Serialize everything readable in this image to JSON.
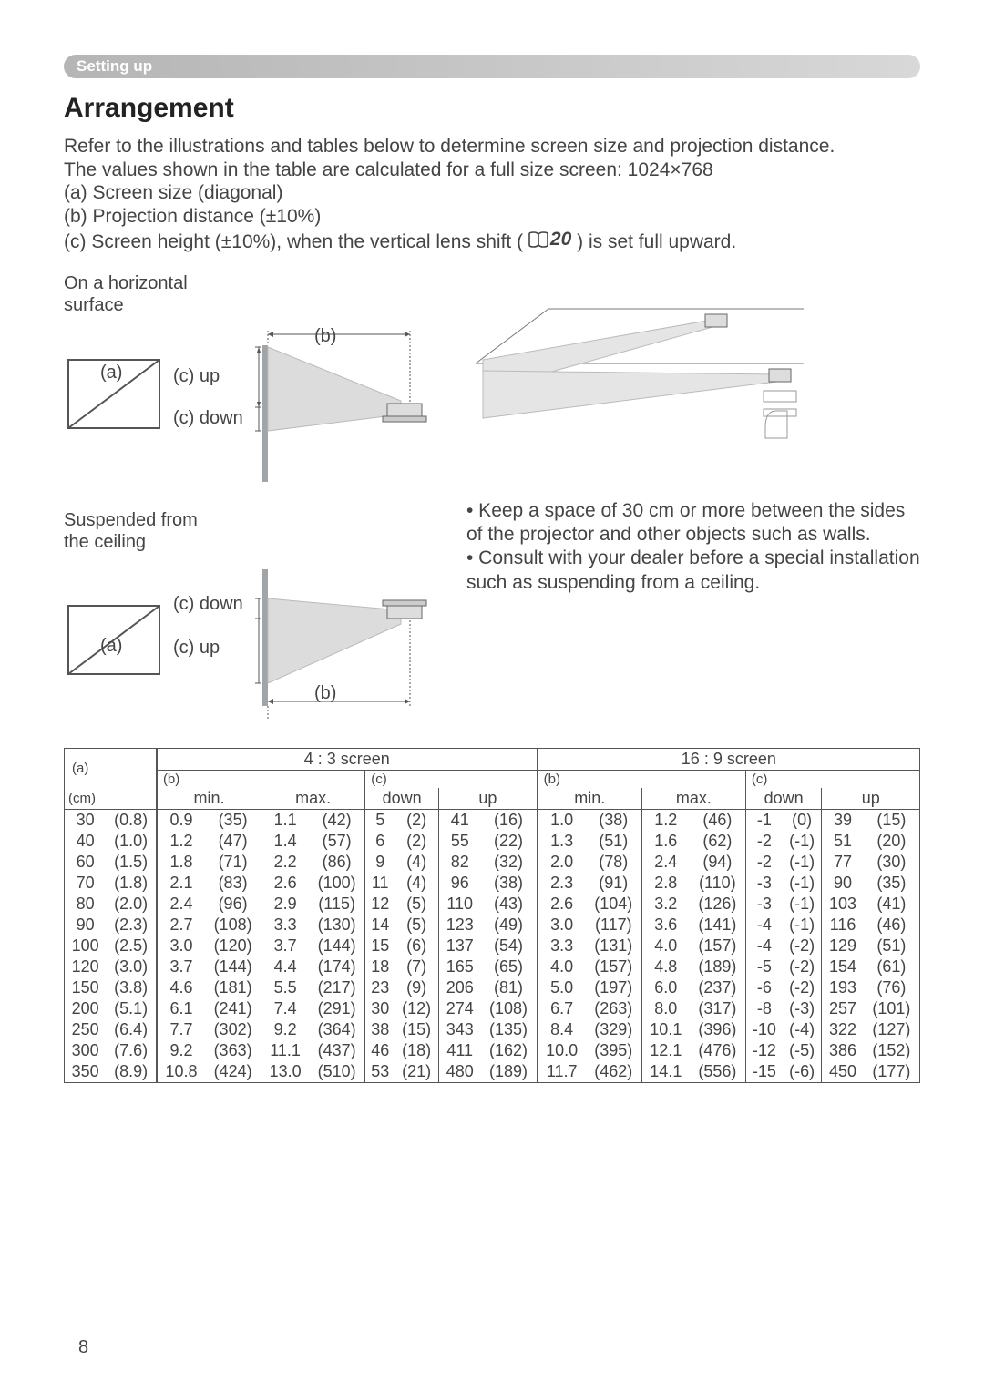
{
  "section_header": "Setting up",
  "title": "Arrangement",
  "intro_line1": "Refer to the illustrations and tables below to determine screen size and projection distance.",
  "intro_line2": "The values shown in the table are calculated for a full size screen: 1024×768",
  "intro_a": "(a) Screen size (diagonal)",
  "intro_b": "(b) Projection distance (±10%)",
  "intro_c_pre": "(c) Screen height (±10%), when the vertical lens shift (",
  "intro_c_ref": "20",
  "intro_c_post": ") is set full upward.",
  "caption_horizontal": "On a horizontal\nsurface",
  "caption_suspended": "Suspended from\nthe ceiling",
  "dl": {
    "a": "(a)",
    "b": "(b)",
    "c_up": "(c) up",
    "c_down": "(c) down"
  },
  "note1": "• Keep a space of 30 cm or more between the sides of the projector and other objects such as walls.",
  "note2": "• Consult with your dealer before a special installation such as suspending from a ceiling.",
  "page_number": "8",
  "table": {
    "hdr_43": "4 : 3 screen",
    "hdr_169": "16 : 9 screen",
    "sub_b": "(b)",
    "sub_c": "(c)",
    "sub_a_line1": "(a)",
    "sub_a_line2": "(cm)",
    "col_min": "min.",
    "col_max": "max.",
    "col_down": "down",
    "col_up": "up",
    "rows": [
      {
        "sz": "30",
        "szp": "(0.8)",
        "a": [
          "0.9",
          "(35)",
          "1.1",
          "(42)",
          "5",
          "(2)",
          "41",
          "(16)"
        ],
        "b": [
          "1.0",
          "(38)",
          "1.2",
          "(46)",
          "-1",
          "(0)",
          "39",
          "(15)"
        ]
      },
      {
        "sz": "40",
        "szp": "(1.0)",
        "a": [
          "1.2",
          "(47)",
          "1.4",
          "(57)",
          "6",
          "(2)",
          "55",
          "(22)"
        ],
        "b": [
          "1.3",
          "(51)",
          "1.6",
          "(62)",
          "-2",
          "(-1)",
          "51",
          "(20)"
        ]
      },
      {
        "sz": "60",
        "szp": "(1.5)",
        "a": [
          "1.8",
          "(71)",
          "2.2",
          "(86)",
          "9",
          "(4)",
          "82",
          "(32)"
        ],
        "b": [
          "2.0",
          "(78)",
          "2.4",
          "(94)",
          "-2",
          "(-1)",
          "77",
          "(30)"
        ]
      },
      {
        "sz": "70",
        "szp": "(1.8)",
        "a": [
          "2.1",
          "(83)",
          "2.6",
          "(100)",
          "11",
          "(4)",
          "96",
          "(38)"
        ],
        "b": [
          "2.3",
          "(91)",
          "2.8",
          "(110)",
          "-3",
          "(-1)",
          "90",
          "(35)"
        ]
      },
      {
        "sz": "80",
        "szp": "(2.0)",
        "a": [
          "2.4",
          "(96)",
          "2.9",
          "(115)",
          "12",
          "(5)",
          "110",
          "(43)"
        ],
        "b": [
          "2.6",
          "(104)",
          "3.2",
          "(126)",
          "-3",
          "(-1)",
          "103",
          "(41)"
        ]
      },
      {
        "sz": "90",
        "szp": "(2.3)",
        "a": [
          "2.7",
          "(108)",
          "3.3",
          "(130)",
          "14",
          "(5)",
          "123",
          "(49)"
        ],
        "b": [
          "3.0",
          "(117)",
          "3.6",
          "(141)",
          "-4",
          "(-1)",
          "116",
          "(46)"
        ]
      },
      {
        "sz": "100",
        "szp": "(2.5)",
        "a": [
          "3.0",
          "(120)",
          "3.7",
          "(144)",
          "15",
          "(6)",
          "137",
          "(54)"
        ],
        "b": [
          "3.3",
          "(131)",
          "4.0",
          "(157)",
          "-4",
          "(-2)",
          "129",
          "(51)"
        ]
      },
      {
        "sz": "120",
        "szp": "(3.0)",
        "a": [
          "3.7",
          "(144)",
          "4.4",
          "(174)",
          "18",
          "(7)",
          "165",
          "(65)"
        ],
        "b": [
          "4.0",
          "(157)",
          "4.8",
          "(189)",
          "-5",
          "(-2)",
          "154",
          "(61)"
        ]
      },
      {
        "sz": "150",
        "szp": "(3.8)",
        "a": [
          "4.6",
          "(181)",
          "5.5",
          "(217)",
          "23",
          "(9)",
          "206",
          "(81)"
        ],
        "b": [
          "5.0",
          "(197)",
          "6.0",
          "(237)",
          "-6",
          "(-2)",
          "193",
          "(76)"
        ]
      },
      {
        "sz": "200",
        "szp": "(5.1)",
        "a": [
          "6.1",
          "(241)",
          "7.4",
          "(291)",
          "30",
          "(12)",
          "274",
          "(108)"
        ],
        "b": [
          "6.7",
          "(263)",
          "8.0",
          "(317)",
          "-8",
          "(-3)",
          "257",
          "(101)"
        ]
      },
      {
        "sz": "250",
        "szp": "(6.4)",
        "a": [
          "7.7",
          "(302)",
          "9.2",
          "(364)",
          "38",
          "(15)",
          "343",
          "(135)"
        ],
        "b": [
          "8.4",
          "(329)",
          "10.1",
          "(396)",
          "-10",
          "(-4)",
          "322",
          "(127)"
        ]
      },
      {
        "sz": "300",
        "szp": "(7.6)",
        "a": [
          "9.2",
          "(363)",
          "11.1",
          "(437)",
          "46",
          "(18)",
          "411",
          "(162)"
        ],
        "b": [
          "10.0",
          "(395)",
          "12.1",
          "(476)",
          "-12",
          "(-5)",
          "386",
          "(152)"
        ]
      },
      {
        "sz": "350",
        "szp": "(8.9)",
        "a": [
          "10.8",
          "(424)",
          "13.0",
          "(510)",
          "53",
          "(21)",
          "480",
          "(189)"
        ],
        "b": [
          "11.7",
          "(462)",
          "14.1",
          "(556)",
          "-15",
          "(-6)",
          "450",
          "(177)"
        ]
      }
    ]
  }
}
